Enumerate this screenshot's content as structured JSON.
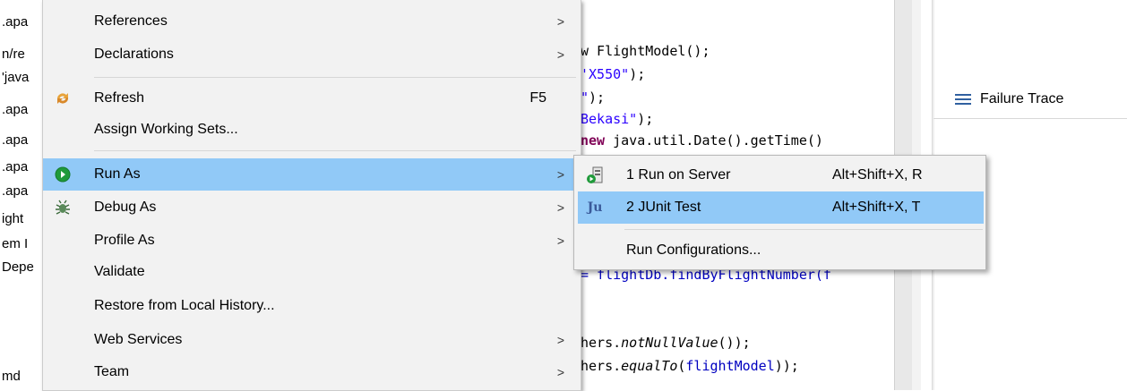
{
  "explorer": {
    "rows": [
      ".apa",
      "n/re",
      "'java",
      ".apa",
      ".apa",
      ".apa",
      ".apa",
      "ight",
      "em I",
      "Depe",
      "md"
    ]
  },
  "editor": {
    "lines": [
      {
        "a": "w FlightModel();"
      },
      {
        "s": "'X550\"",
        "b": ");"
      },
      {
        "s": "\"",
        "b": ");"
      },
      {
        "s": "Bekasi\"",
        "b": ");"
      },
      {
        "k": "new",
        "b": " java.util.Date().getTime()"
      },
      {
        "f": "= flightDb.findByFlightNumber(f"
      },
      {
        "a": "hers.",
        "i": "notNullValue",
        "b": "());"
      },
      {
        "a": "hers.",
        "i": "equalTo",
        "c": "(",
        "f": "flightModel",
        "b": "));"
      }
    ]
  },
  "failure_trace": {
    "label": "Failure Trace",
    "icon": "list-icon"
  },
  "context_menu": {
    "items": [
      {
        "label": "References",
        "submenu": true
      },
      {
        "label": "Declarations",
        "submenu": true
      },
      {
        "label": "Refresh",
        "shortcut": "F5",
        "icon": "refresh-icon"
      },
      {
        "label": "Assign Working Sets..."
      },
      {
        "label": "Run As",
        "submenu": true,
        "icon": "run-icon",
        "highlighted": true
      },
      {
        "label": "Debug As",
        "submenu": true,
        "icon": "debug-bug-icon"
      },
      {
        "label": "Profile As",
        "submenu": true
      },
      {
        "label": "Validate"
      },
      {
        "label": "Restore from Local History..."
      },
      {
        "label": "Web Services",
        "submenu": true
      },
      {
        "label": "Team",
        "submenu": true
      }
    ],
    "arrow": ">"
  },
  "run_as_submenu": {
    "items": [
      {
        "label": "1 Run on Server",
        "shortcut": "Alt+Shift+X, R",
        "icon": "server-run-icon"
      },
      {
        "label": "2 JUnit Test",
        "shortcut": "Alt+Shift+X, T",
        "icon": "junit-icon",
        "icon_text": "Ju",
        "highlighted": true
      },
      {
        "label": "Run Configurations..."
      }
    ]
  },
  "colors": {
    "highlight": "#91c9f7",
    "menu_bg": "#f2f2f2",
    "run_green": "#1f9a3a",
    "string": "#2a00ff",
    "keyword": "#7f0055",
    "field": "#0000c0"
  }
}
